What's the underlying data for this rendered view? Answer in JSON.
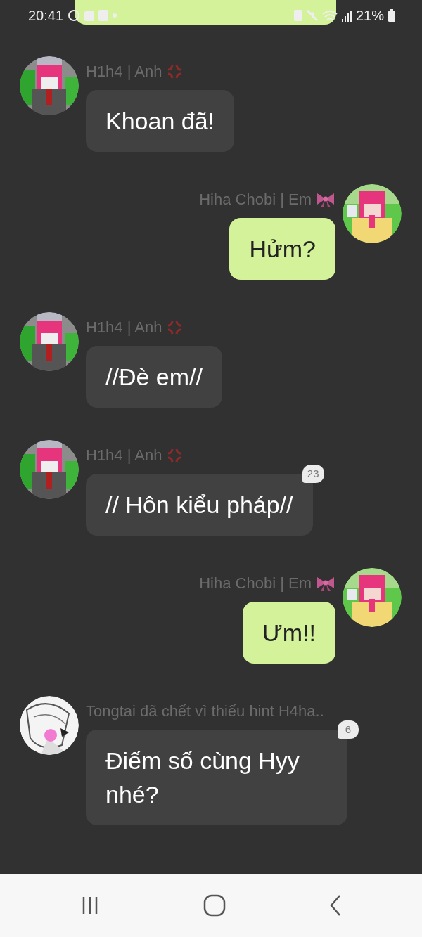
{
  "status_bar": {
    "time": "20:41",
    "battery": "21%"
  },
  "messages": [
    {
      "kind": "sent",
      "cut": true
    },
    {
      "kind": "received",
      "name": "H1h4 | Anh",
      "tag": {
        "kind": "anger"
      },
      "text": "Khoan đã!"
    },
    {
      "kind": "sent",
      "name": "Hiha Chobi | Em",
      "tag": {
        "kind": "bow"
      },
      "text": "Hửm?"
    },
    {
      "kind": "received",
      "name": "H1h4 | Anh",
      "tag": {
        "kind": "anger"
      },
      "text": "//Đè em//"
    },
    {
      "kind": "received",
      "name": "H1h4 | Anh",
      "tag": {
        "kind": "anger"
      },
      "text": "// Hôn kiểu pháp//",
      "reactions": "23"
    },
    {
      "kind": "sent",
      "name": "Hiha Chobi | Em",
      "tag": {
        "kind": "bow"
      },
      "text": "Ưm!!"
    },
    {
      "kind": "received",
      "name": "Tongtai đã chết vì thiếu hint H4ha..",
      "text": "Điếm số cùng Hyy nhé?",
      "reactions": "6"
    }
  ]
}
